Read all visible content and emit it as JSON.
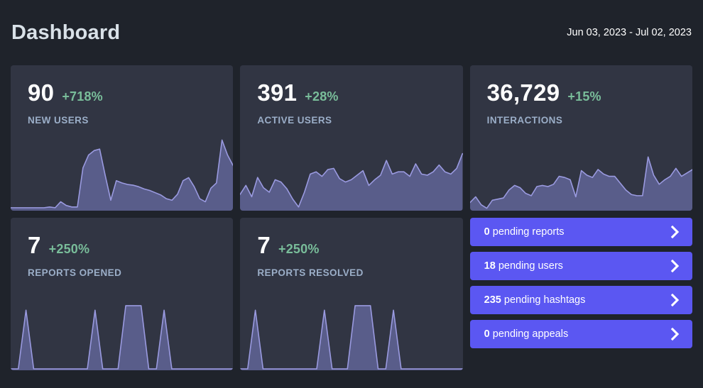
{
  "header": {
    "title": "Dashboard",
    "date_range": "Jun 03, 2023 - Jul 02, 2023"
  },
  "colors": {
    "page_bg": "#1f232b",
    "card_bg": "#313543",
    "accent_button": "#5b57f2",
    "positive_delta": "#79bd9a",
    "label": "#9baec8",
    "spark_stroke": "#9a9ae0",
    "spark_fill": "#595d8a"
  },
  "cards": [
    {
      "value": "90",
      "delta": "+718%",
      "label": "NEW USERS",
      "chart_data": {
        "type": "area",
        "title": "New users",
        "values": [
          2,
          2,
          2,
          2,
          2,
          2,
          2,
          3,
          2,
          10,
          5,
          3,
          3,
          55,
          72,
          78,
          80,
          45,
          12,
          38,
          35,
          33,
          32,
          30,
          27,
          25,
          22,
          19,
          14,
          12,
          20,
          38,
          42,
          30,
          14,
          10,
          28,
          35,
          92,
          72,
          58
        ],
        "ylim": [
          0,
          100
        ],
        "xlabel": "",
        "ylabel": "",
        "grid": false
      }
    },
    {
      "value": "391",
      "delta": "+28%",
      "label": "ACTIVE USERS",
      "chart_data": {
        "type": "area",
        "title": "Active users",
        "values": [
          26,
          42,
          22,
          56,
          38,
          30,
          52,
          48,
          36,
          18,
          4,
          30,
          62,
          66,
          58,
          70,
          72,
          54,
          48,
          52,
          60,
          68,
          42,
          52,
          60,
          86,
          62,
          66,
          66,
          58,
          80,
          62,
          60,
          66,
          78,
          66,
          62,
          72,
          98
        ],
        "ylim": [
          0,
          100
        ],
        "xlabel": "",
        "ylabel": "",
        "grid": false
      }
    },
    {
      "value": "36,729",
      "delta": "+15%",
      "label": "INTERACTIONS",
      "chart_data": {
        "type": "area",
        "title": "Interactions",
        "values": [
          12,
          22,
          8,
          2,
          16,
          18,
          20,
          34,
          42,
          38,
          28,
          24,
          40,
          42,
          40,
          44,
          58,
          56,
          52,
          22,
          68,
          60,
          56,
          70,
          62,
          58,
          58,
          46,
          34,
          26,
          24,
          24,
          92,
          60,
          44,
          52,
          58,
          72,
          58,
          64,
          70
        ],
        "ylim": [
          0,
          100
        ],
        "xlabel": "",
        "ylabel": "",
        "grid": false
      }
    },
    {
      "value": "7",
      "delta": "+250%",
      "label": "REPORTS OPENED",
      "chart_data": {
        "type": "area",
        "title": "Reports opened",
        "values": [
          0,
          0,
          78,
          0,
          0,
          0,
          0,
          0,
          0,
          0,
          0,
          78,
          0,
          0,
          0,
          84,
          84,
          84,
          0,
          0,
          78,
          0,
          0,
          0,
          0,
          0,
          0,
          0,
          0,
          0
        ],
        "ylim": [
          0,
          100
        ],
        "xlabel": "",
        "ylabel": "",
        "grid": false
      }
    },
    {
      "value": "7",
      "delta": "+250%",
      "label": "REPORTS RESOLVED",
      "chart_data": {
        "type": "area",
        "title": "Reports resolved",
        "values": [
          0,
          0,
          78,
          0,
          0,
          0,
          0,
          0,
          0,
          0,
          0,
          78,
          0,
          0,
          0,
          84,
          84,
          84,
          0,
          0,
          78,
          0,
          0,
          0,
          0,
          0,
          0,
          0,
          0,
          0
        ],
        "ylim": [
          0,
          100
        ],
        "xlabel": "",
        "ylabel": "",
        "grid": false
      }
    }
  ],
  "pending": [
    {
      "count": "0",
      "text": " pending reports",
      "icon": "chevron-right-icon"
    },
    {
      "count": "18",
      "text": " pending users",
      "icon": "chevron-right-icon"
    },
    {
      "count": "235",
      "text": " pending hashtags",
      "icon": "chevron-right-icon"
    },
    {
      "count": "0",
      "text": " pending appeals",
      "icon": "chevron-right-icon"
    }
  ]
}
